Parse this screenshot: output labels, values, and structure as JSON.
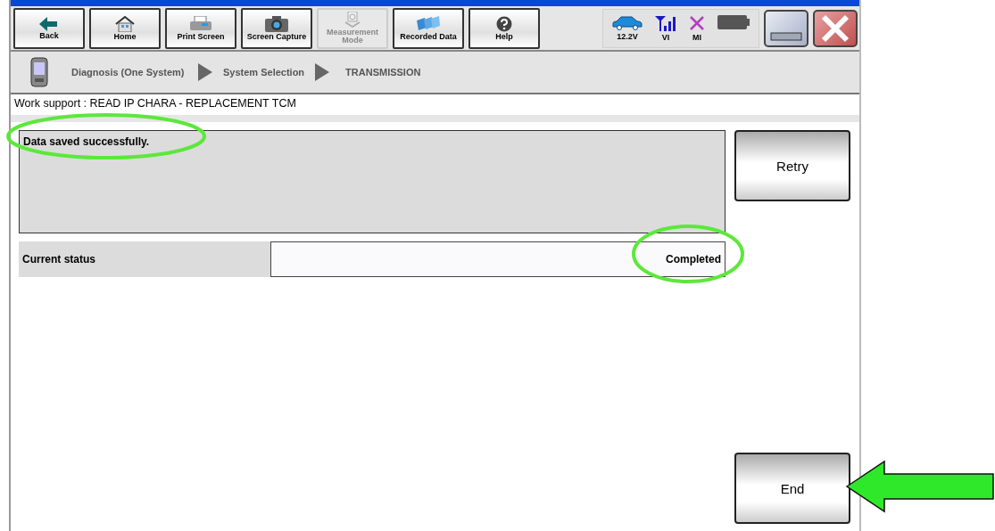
{
  "toolbar": [
    {
      "label": "Back",
      "kind": "back",
      "disabled": false
    },
    {
      "label": "Home",
      "kind": "home",
      "disabled": false
    },
    {
      "label": "Print Screen",
      "kind": "printer",
      "disabled": false
    },
    {
      "label": "Screen Capture",
      "kind": "camera",
      "disabled": false
    },
    {
      "label": "Measurement Mode",
      "kind": "meter",
      "disabled": true
    },
    {
      "label": "Recorded Data",
      "kind": "folders",
      "disabled": false
    },
    {
      "label": "Help",
      "kind": "help",
      "disabled": false
    }
  ],
  "status_icons": [
    {
      "label": "12.2V",
      "kind": "car"
    },
    {
      "label": "VI",
      "kind": "signal"
    },
    {
      "label": "MI",
      "kind": "cross"
    }
  ],
  "breadcrumb": [
    "Diagnosis (One System)",
    "System Selection",
    "TRANSMISSION"
  ],
  "work_support": "Work support : READ IP CHARA - REPLACEMENT TCM",
  "message": "Data saved successfully.",
  "status": {
    "label": "Current status",
    "value": "Completed"
  },
  "buttons": {
    "retry": "Retry",
    "end": "End"
  }
}
